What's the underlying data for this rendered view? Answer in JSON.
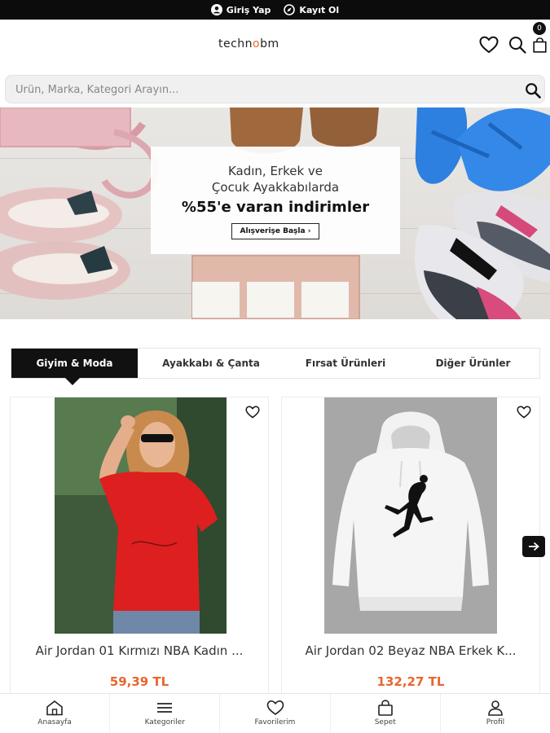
{
  "topbar": {
    "login": "Giriş Yap",
    "register": "Kayıt Ol"
  },
  "header": {
    "logo_pre": "techn",
    "logo_mid": "o",
    "logo_post": "bm",
    "cart_count": "0"
  },
  "search": {
    "placeholder": "Ürün, Marka, Kategori Arayın..."
  },
  "banner": {
    "line1": "Kadın, Erkek ve",
    "line2": "Çocuk Ayakkabılarda",
    "headline": "%55'e varan indirimler",
    "cta": "Alışverişe Başla"
  },
  "tabs": [
    {
      "label": "Giyim & Moda"
    },
    {
      "label": "Ayakkabı & Çanta"
    },
    {
      "label": "Fırsat Ürünleri"
    },
    {
      "label": "Diğer Ürünler"
    }
  ],
  "products": [
    {
      "name": "Air Jordan 01 Kırmızı NBA Kadın ...",
      "price": "59,39 TL"
    },
    {
      "name": "Air Jordan 02 Beyaz NBA Erkek K...",
      "price": "132,27 TL"
    }
  ],
  "bottom_nav": [
    {
      "label": "Anasayfa",
      "icon": "home-icon"
    },
    {
      "label": "Kategoriler",
      "icon": "menu-icon"
    },
    {
      "label": "Favorilerim",
      "icon": "heart-icon"
    },
    {
      "label": "Sepet",
      "icon": "bag-icon"
    },
    {
      "label": "Profil",
      "icon": "user-icon"
    }
  ],
  "colors": {
    "accent": "#e8662e",
    "dark": "#111111"
  }
}
